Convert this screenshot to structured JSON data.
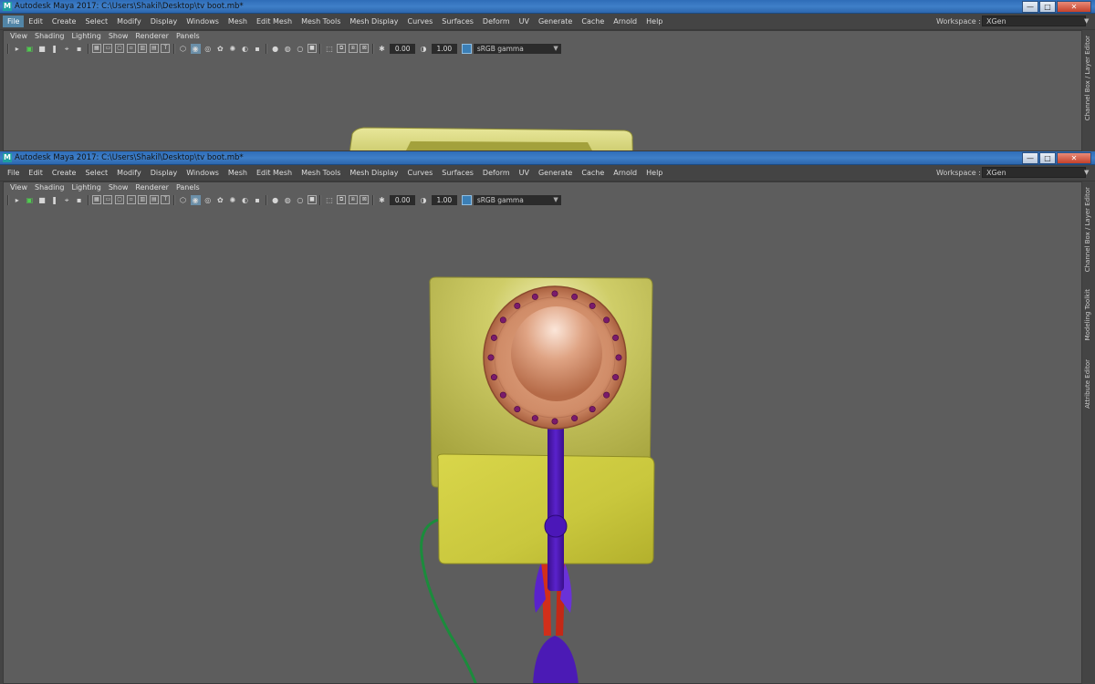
{
  "windows": [
    {
      "title": "Autodesk Maya 2017: C:\\Users\\Shakil\\Desktop\\tv boot.mb*",
      "active_menu": "File"
    },
    {
      "title": "Autodesk Maya 2017: C:\\Users\\Shakil\\Desktop\\tv boot.mb*",
      "active_menu": ""
    }
  ],
  "app_logo": "M",
  "window_buttons": {
    "minimize": "—",
    "maximize": "□",
    "close": "✕"
  },
  "menu": [
    "File",
    "Edit",
    "Create",
    "Select",
    "Modify",
    "Display",
    "Windows",
    "Mesh",
    "Edit Mesh",
    "Mesh Tools",
    "Mesh Display",
    "Curves",
    "Surfaces",
    "Deform",
    "UV",
    "Generate",
    "Cache",
    "Arnold",
    "Help"
  ],
  "workspace": {
    "label": "Workspace :",
    "value": "XGen"
  },
  "panel_menu": [
    "View",
    "Shading",
    "Lighting",
    "Show",
    "Renderer",
    "Panels"
  ],
  "toolbar": {
    "exposure": "0.00",
    "gamma": "1.00",
    "color_space": "sRGB gamma"
  },
  "side_tabs": [
    "Channel Box / Layer Editor",
    "Modeling Toolkit",
    "Attribute Editor"
  ],
  "colors": {
    "viewport_bg": "#5d5d5d",
    "title_bar": "#3f7fc8",
    "tv_body": "#c4c25a",
    "dial": "#d59574",
    "stem": "#4e18b5",
    "cable": "#1a8a3a",
    "legs": "#d0301c",
    "studs": "#7a1b6b"
  },
  "icons": [
    "select-tool-icon",
    "move-tool-icon",
    "camera-icon",
    "bookmark-icon",
    "grid-icon",
    "wireframe-icon",
    "smooth-shade-icon",
    "lighting-icon",
    "shadow-icon",
    "texture-icon",
    "isolate-icon",
    "xray-icon",
    "gamma-icon"
  ]
}
